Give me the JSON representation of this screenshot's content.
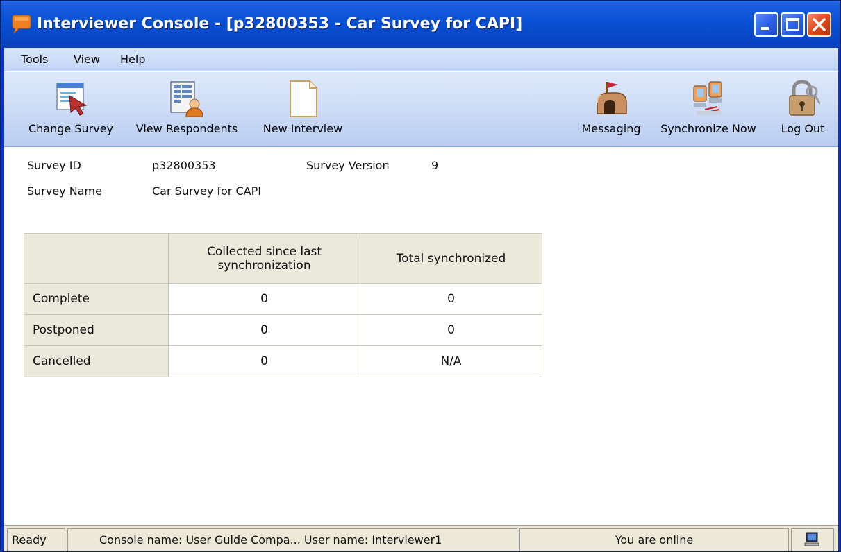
{
  "window": {
    "title": "Interviewer Console - [p32800353 - Car Survey for CAPI]",
    "icons": {
      "app": "chat-bubble-icon",
      "minimize": "minimize-icon",
      "maximize": "maximize-icon",
      "close": "close-icon"
    },
    "colors": {
      "titlebar": "#0a52d6",
      "close": "#e04a1c"
    }
  },
  "menu": {
    "items": [
      {
        "label": "Tools"
      },
      {
        "label": "View"
      },
      {
        "label": "Help"
      }
    ]
  },
  "toolbar": {
    "left": [
      {
        "label": "Change Survey",
        "icon": "change-survey-icon"
      },
      {
        "label": "View Respondents",
        "icon": "view-respondents-icon"
      },
      {
        "label": "New Interview",
        "icon": "new-document-icon"
      }
    ],
    "right": [
      {
        "label": "Messaging",
        "icon": "mailbox-icon"
      },
      {
        "label": "Synchronize Now",
        "icon": "synchronize-icon"
      },
      {
        "label": "Log Out",
        "icon": "padlock-icon"
      }
    ]
  },
  "survey": {
    "id_label": "Survey ID",
    "id_value": "p32800353",
    "version_label": "Survey Version",
    "version_value": "9",
    "name_label": "Survey Name",
    "name_value": "Car Survey for CAPI"
  },
  "stats": {
    "headers": [
      "",
      "Collected since last synchronization",
      "Total synchronized"
    ],
    "rows": [
      {
        "label": "Complete",
        "collected": "0",
        "total": "0"
      },
      {
        "label": "Postponed",
        "collected": "0",
        "total": "0"
      },
      {
        "label": "Cancelled",
        "collected": "0",
        "total": "N/A"
      }
    ]
  },
  "status": {
    "ready": "Ready",
    "console": "Console name:  User Guide Compa...  User name: Interviewer1",
    "online": "You are online",
    "icon": "computer-icon"
  }
}
